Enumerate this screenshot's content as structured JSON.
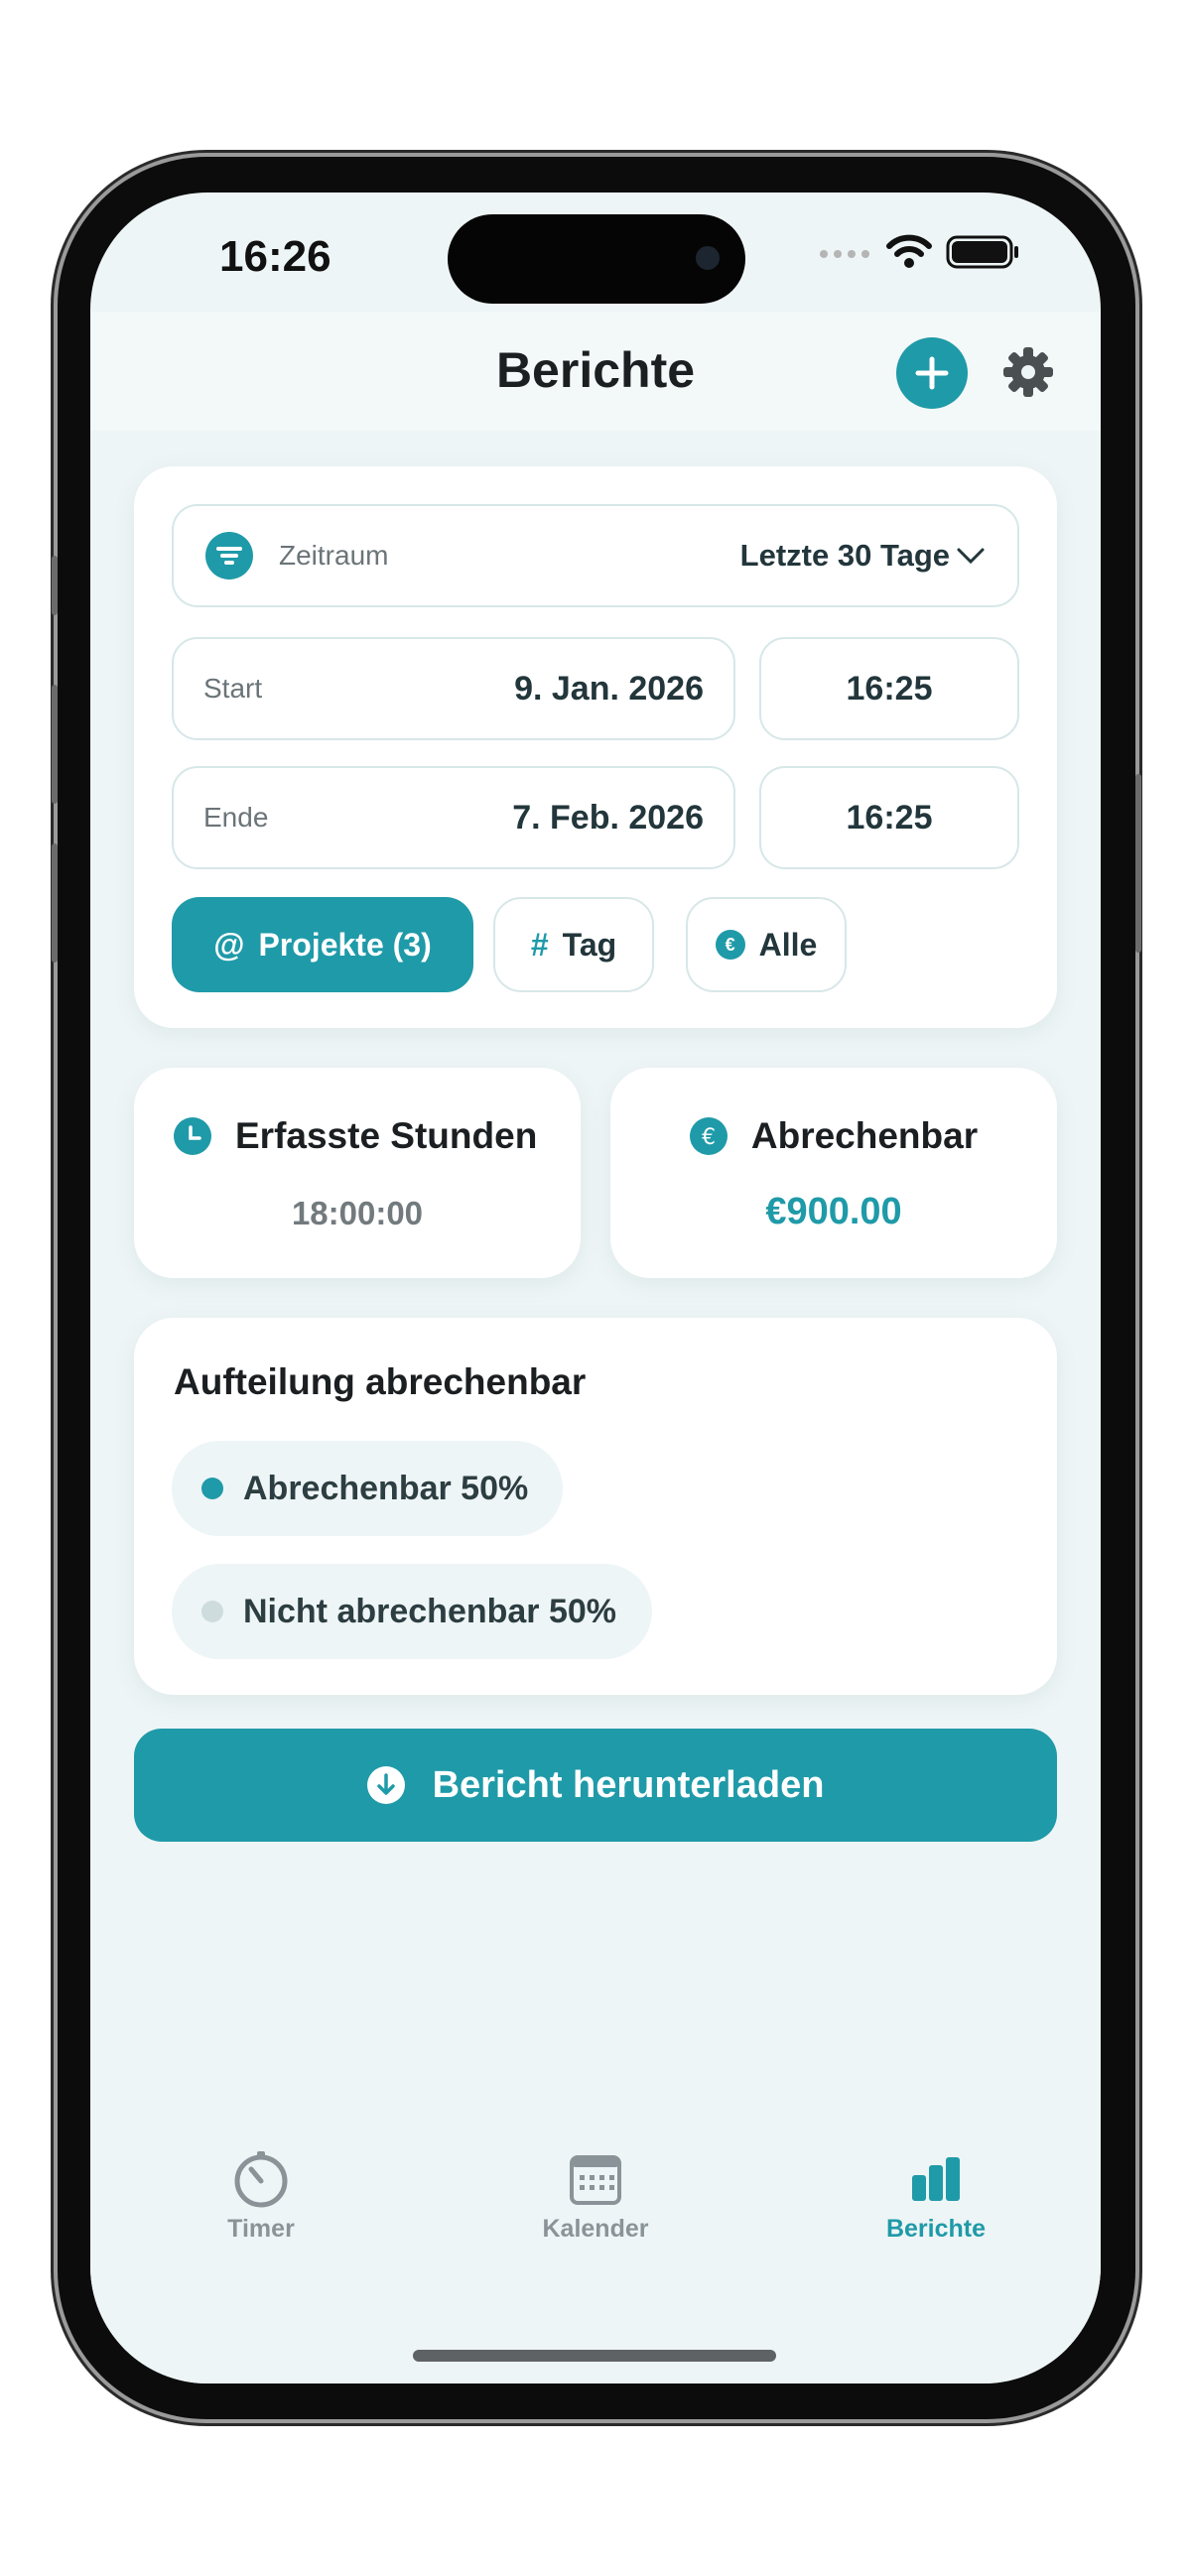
{
  "status": {
    "time": "16:26"
  },
  "header": {
    "title": "Berichte"
  },
  "filters": {
    "period_label": "Zeitraum",
    "period_value": "Letzte 30 Tage",
    "start_label": "Start",
    "start_date": "9. Jan. 2026",
    "start_time": "16:25",
    "end_label": "Ende",
    "end_date": "7. Feb. 2026",
    "end_time": "16:25",
    "chips": [
      {
        "symbol": "@",
        "label": "Projekte (3)",
        "active": true
      },
      {
        "symbol": "#",
        "label": "Tag",
        "active": false
      },
      {
        "symbol": "€",
        "label": "Alle",
        "active": false
      }
    ]
  },
  "stats": {
    "hours_title": "Erfasste Stunden",
    "hours_value": "18:00:00",
    "billable_title": "Abrechenbar",
    "billable_value": "€900.00"
  },
  "breakdown": {
    "title": "Aufteilung abrechenbar",
    "items": [
      {
        "label": "Abrechenbar 50%",
        "color": "#1f9aa8"
      },
      {
        "label": "Nicht abrechenbar 50%",
        "color": "#cfdcdd"
      }
    ]
  },
  "download": {
    "label": "Bericht herunterladen"
  },
  "tabs": [
    {
      "label": "Timer",
      "icon": "timer-icon",
      "active": false
    },
    {
      "label": "Kalender",
      "icon": "calendar-icon",
      "active": false
    },
    {
      "label": "Berichte",
      "icon": "bar-chart-icon",
      "active": true
    }
  ],
  "colors": {
    "accent": "#1f9aa8",
    "background": "#eef5f6",
    "inactive": "#8a9498"
  }
}
